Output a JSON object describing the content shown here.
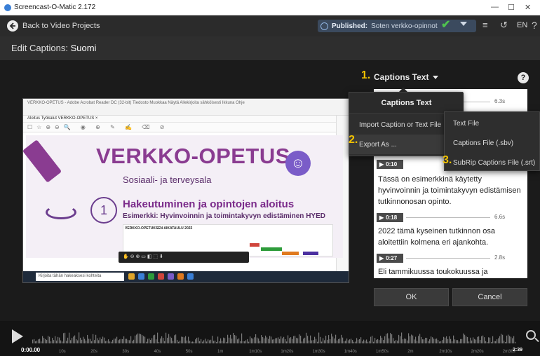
{
  "window": {
    "title": "Screencast-O-Matic 2.172"
  },
  "topbar": {
    "back_label": "Back to Video Projects",
    "published_prefix": "Published:",
    "published_target": "Soten verkko-opinnot",
    "language": "EN"
  },
  "page": {
    "title_prefix": "Edit Captions:",
    "title_lang": "Suomi"
  },
  "preview": {
    "menu_text": "VERKKO-OPETUS - Adobe Acrobat Reader DC (32-bit)   Tiedosto  Muokkaa  Näytä  Allekirjoita sähköisesti  Ikkuna  Ohje",
    "tabs_text": "Aloitus   Työkalut      VERKKO-OPETUS  ×",
    "slide_title": "VERKKO-OPETUS",
    "slide_sub": "Sosiaali- ja terveysala",
    "slide_number": "1",
    "slide_heading": "Hakeutuminen ja opintojen aloitus",
    "slide_heading2": "Esimerkki: Hyvinvoinnin ja toimintakyvyn edistäminen HYED",
    "schedule_title": "VERKKO-OPETUKSEN AIKATAULU 2022",
    "taskbar_search": "Kirjoita tähän hakeaksesi kohteita"
  },
  "captions": {
    "header": "Captions Text",
    "entries": [
      {
        "time": "",
        "duration": "6.3s",
        "text": ""
      },
      {
        "time": "0:10",
        "duration": "",
        "text": "Tässä on esimerkkinä käytetty hyvinvoinnin ja toimintakyvyn edistämisen tutkinnonosan opinto."
      },
      {
        "time": "0:18",
        "duration": "6.6s",
        "text": "2022 tämä kyseinen tutkinnon osa aloitettiin kolmena eri ajankohta."
      },
      {
        "time": "0:27",
        "duration": "2.8s",
        "text": "Eli tammikuussa toukokuussa ja"
      }
    ]
  },
  "menu_main": {
    "title": "Captions Text",
    "items": [
      "Import Caption or Text File",
      "Export As ..."
    ]
  },
  "menu_export": {
    "items": [
      "Text File",
      "Captions File (.sbv)",
      "SubRip Captions File (.srt)"
    ]
  },
  "annotations": [
    "1.",
    "2.",
    "3."
  ],
  "buttons": {
    "ok": "OK",
    "cancel": "Cancel"
  },
  "timeline": {
    "current": "0:00.00",
    "end": "2:39",
    "ticks": [
      "10s",
      "20s",
      "30s",
      "40s",
      "50s",
      "1m",
      "1m10s",
      "1m20s",
      "1m30s",
      "1m40s",
      "1m50s",
      "2m",
      "2m10s",
      "2m20s",
      "2m30s"
    ]
  },
  "colors": {
    "accent_yellow": "#f2c200",
    "published_bg": "#3b4a5e",
    "check_green": "#4fc24f",
    "slide_purple": "#8a3c91"
  }
}
